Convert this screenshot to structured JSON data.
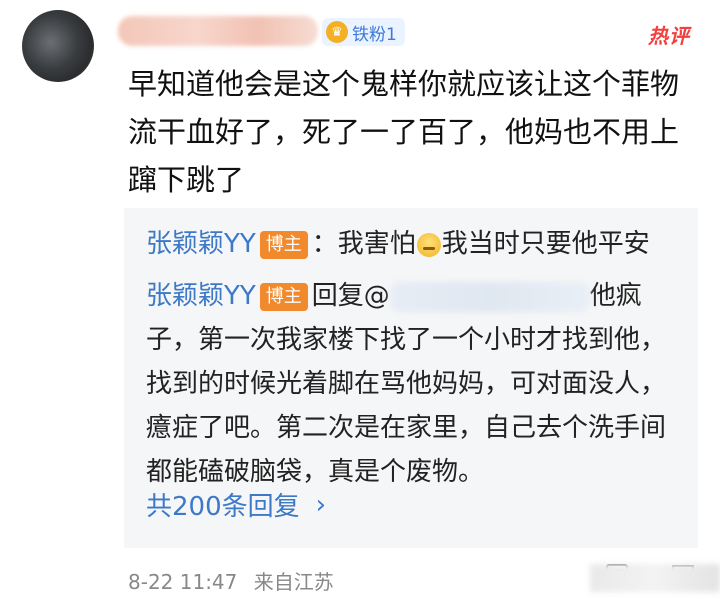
{
  "comment": {
    "fan_badge": "铁粉1",
    "hot_tag": "热评",
    "text": "早知道他会是这个鬼样你就应该让这个菲物流干血好了，死了一了百了，他妈也不用上蹿下跳了"
  },
  "replies": [
    {
      "name": "张颖颖YY",
      "badge": "博主",
      "pre": "：我害怕",
      "post": "我当时只要他平安"
    },
    {
      "name": "张颖颖YY",
      "badge": "博主",
      "reply_prefix": "回复@",
      "tail": "他疯",
      "body": "子，第一次我家楼下找了一个小时才找到他，找到的时候光着脚在骂他妈妈，可对面没人，癔症了吧。第二次是在家里，自己去个洗手间都能磕破脑袋，真是个废物。"
    }
  ],
  "more_replies": "共200条回复",
  "footer": {
    "date": "8-22 11:47",
    "location": "来自江苏"
  },
  "icons": [
    "share-icon",
    "comment-icon",
    "chevron-right-icon",
    "fan-badge-icon",
    "emoji-icon"
  ]
}
